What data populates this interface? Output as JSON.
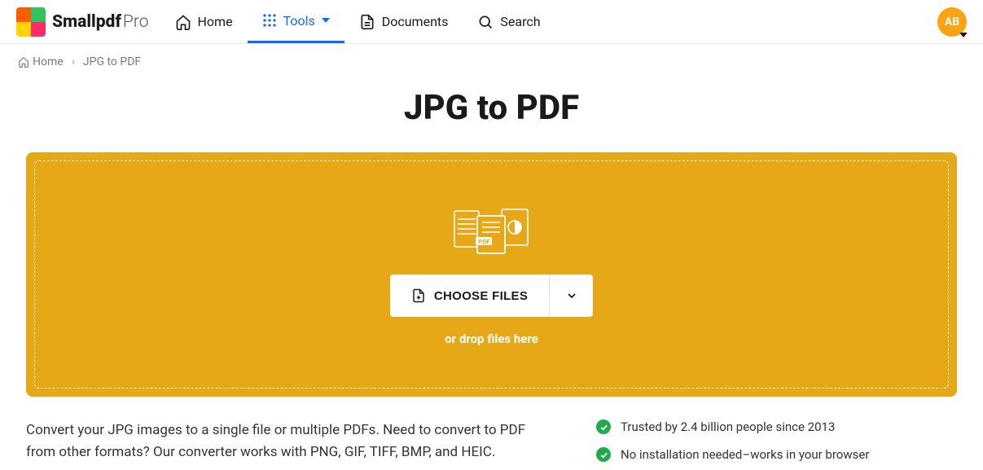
{
  "brand": {
    "name": "Smallpdf",
    "suffix": "Pro"
  },
  "nav": {
    "home": "Home",
    "tools": "Tools",
    "documents": "Documents",
    "search": "Search"
  },
  "avatar": {
    "initials": "AB"
  },
  "breadcrumb": {
    "home": "Home",
    "current": "JPG to PDF"
  },
  "page": {
    "title": "JPG to PDF"
  },
  "dropzone": {
    "choose_label": "CHOOSE FILES",
    "hint": "or drop files here"
  },
  "description": "Convert your JPG images to a single file or multiple PDFs. Need to convert to PDF from other formats? Our converter works with PNG, GIF, TIFF, BMP, and HEIC.",
  "benefits": [
    "Trusted by 2.4 billion people since 2013",
    "No installation needed–works in your browser"
  ],
  "colors": {
    "accent_blue": "#1565ff",
    "dropzone_bg": "#e6a817",
    "avatar_bg": "#fca311",
    "check_green": "#22a94d"
  }
}
